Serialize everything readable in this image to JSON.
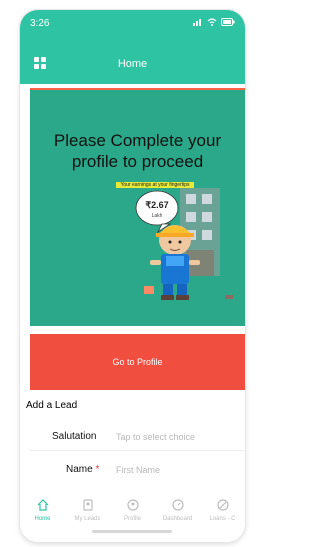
{
  "status_bar": {
    "time": "3:26",
    "icons": "signal wifi battery"
  },
  "header": {
    "title": "Home",
    "menu_icon": "grid-icon"
  },
  "hero": {
    "headline": "Please Complete your profile to proceed",
    "tagline": "Your earnings at your fingertips",
    "bubble_amount": "₹2.67",
    "bubble_unit": "Lakh"
  },
  "cta": {
    "label": "Go to Profile"
  },
  "lead_form": {
    "title": "Add a Lead",
    "salutation_label": "Salutation",
    "salutation_placeholder": "Tap to select choice",
    "name_label": "Name",
    "name_required": "*",
    "name_placeholder": "First Name"
  },
  "tabs": [
    {
      "label": "Home",
      "icon": "home-icon",
      "active": true
    },
    {
      "label": "My Leads",
      "icon": "leads-icon"
    },
    {
      "label": "Profile",
      "icon": "profile-icon"
    },
    {
      "label": "Dashboard",
      "icon": "dashboard-icon"
    },
    {
      "label": "Loans - C",
      "icon": "loans-icon"
    }
  ],
  "colors": {
    "accent": "#2dc3a3",
    "hero_bg": "#2aa889",
    "cta_bg": "#f04e3f"
  }
}
